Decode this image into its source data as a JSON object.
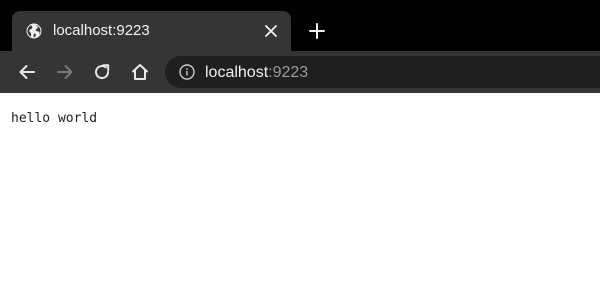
{
  "tab": {
    "title": "localhost:9223",
    "favicon": "globe-icon",
    "close_icon": "close-icon"
  },
  "new_tab_icon": "plus-icon",
  "toolbar": {
    "back_icon": "arrow-left-icon",
    "forward_icon": "arrow-right-icon",
    "reload_icon": "reload-icon",
    "home_icon": "home-icon"
  },
  "omnibox": {
    "info_icon": "info-icon",
    "host": "localhost",
    "port": ":9223"
  },
  "page": {
    "text": "hello world"
  },
  "colors": {
    "tabstrip_bg": "#000000",
    "tab_bg": "#353535",
    "toolbar_bg": "#353535",
    "omnibox_bg": "#1f1f1f",
    "page_bg": "#ffffff"
  }
}
